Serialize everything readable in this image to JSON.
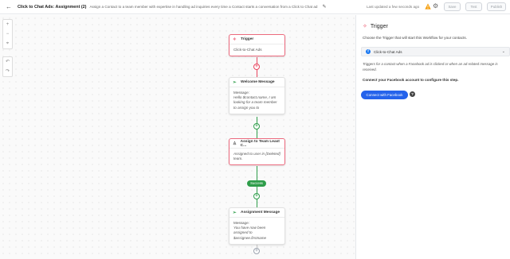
{
  "header": {
    "back_icon": "arrow-left-icon",
    "title": "Click to Chat Ads: Assignment (2)",
    "description": "Assign a Contact to a team member with expertise in handling ad inquiries every time a Contact starts a conversation from a Click to Chat ad",
    "last_updated": "Last updated a few seconds ago",
    "save_label": "Save",
    "test_label": "Test",
    "publish_label": "Publish"
  },
  "canvas_tools": {
    "zoom_in": "+",
    "zoom_out": "−",
    "fit": "⌖",
    "undo": "↶",
    "redo": "↷"
  },
  "nodes": {
    "trigger": {
      "title": "Trigger",
      "body": "Click-to-Chat Ads"
    },
    "welcome": {
      "title": "Welcome Message",
      "label": "Message:",
      "text": "Hello $contact.name, I am looking for a team member to assign you to"
    },
    "assign": {
      "title": "Assign to Team Least C...",
      "line1": "Assigned to user in [Deleted]",
      "line2": "team."
    },
    "assignment_msg": {
      "title": "Assignment Message",
      "label": "Message:",
      "text": "You have now been assigned to $assignee.firstname"
    },
    "success_label": "Success"
  },
  "panel": {
    "title": "Trigger",
    "subtitle": "Choose the Trigger that will start this Workflow for your contacts.",
    "selected_trigger": "Click-to-Chat Ads",
    "trigger_description": "Triggers for a contact when a Facebook ad is clicked or when an ad-related message is received.",
    "connect_text": "Connect your Facebook account to configure this step.",
    "connect_button": "Connect with Facebook"
  },
  "colors": {
    "trigger_red": "#e8455f",
    "green": "#2e9d4a",
    "blue_button": "#2563eb"
  }
}
